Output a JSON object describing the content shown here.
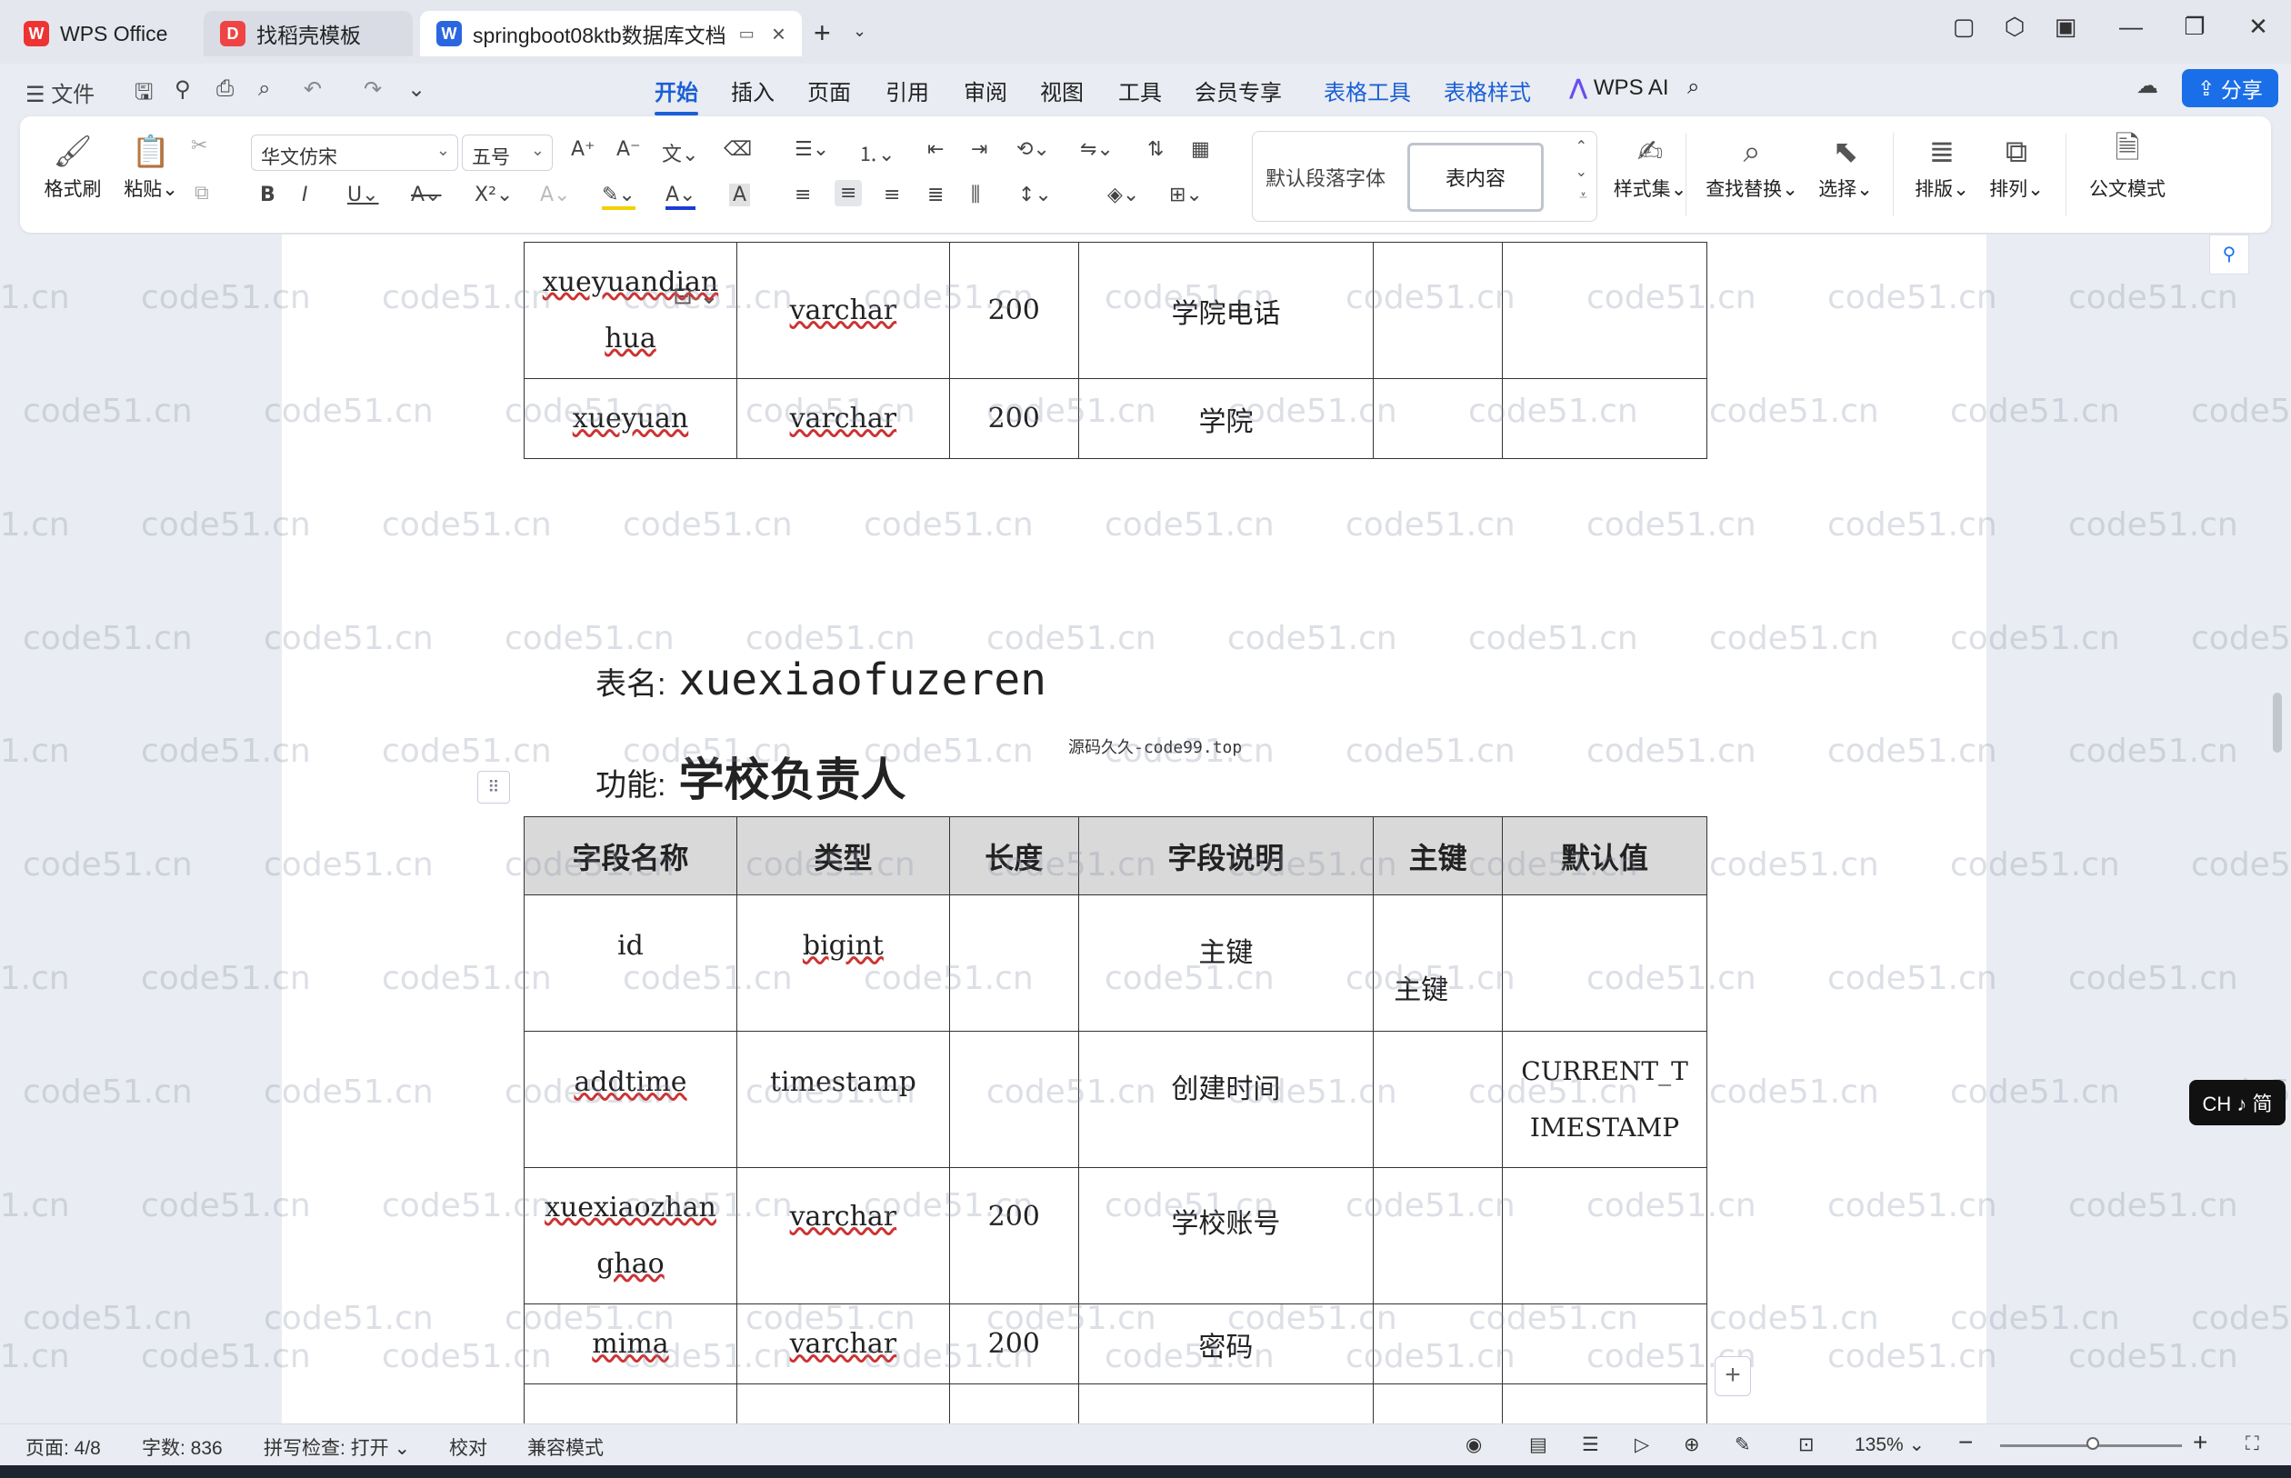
{
  "tabs": {
    "wps": "WPS Office",
    "template": "找稻壳模板",
    "doc": "springboot08ktb数据库文档"
  },
  "menu": {
    "file": "文件",
    "items": [
      "开始",
      "插入",
      "页面",
      "引用",
      "审阅",
      "视图",
      "工具",
      "会员专享",
      "表格工具",
      "表格样式"
    ],
    "wps_ai": "WPS AI",
    "share": "分享"
  },
  "ribbon": {
    "format_painter": "格式刷",
    "paste": "粘贴",
    "font_name": "华文仿宋",
    "font_size": "五号",
    "style_default": "默认段落字体",
    "style_selected": "表内容",
    "styles": "样式集",
    "find_replace": "查找替换",
    "select": "选择",
    "layout": "排版",
    "arrange": "排列",
    "official": "公文模式"
  },
  "prev_table": {
    "rows": [
      {
        "name": "xueyuandianhua",
        "type": "varchar",
        "length": "200",
        "desc": "学院电话",
        "pk": "",
        "default": ""
      },
      {
        "name": "xueyuan",
        "type": "varchar",
        "length": "200",
        "desc": "学院",
        "pk": "",
        "default": ""
      }
    ]
  },
  "table_info": {
    "name_label": "表名:",
    "name_value": "xuexiaofuzeren",
    "func_label": "功能:",
    "func_value": "学校负责人",
    "source": "源码久久-code99.top"
  },
  "main_table": {
    "headers": [
      "字段名称",
      "类型",
      "长度",
      "字段说明",
      "主键",
      "默认值"
    ],
    "rows": [
      {
        "name": "id",
        "type": "bigint",
        "length": "",
        "desc": "主键",
        "pk": "主键",
        "default": ""
      },
      {
        "name": "addtime",
        "type": "timestamp",
        "length": "",
        "desc": "创建时间",
        "pk": "",
        "default": "CURRENT_TIMESTAMP"
      },
      {
        "name": "xuexiaozhanghao",
        "type": "varchar",
        "length": "200",
        "desc": "学校账号",
        "pk": "",
        "default": ""
      },
      {
        "name": "mima",
        "type": "varchar",
        "length": "200",
        "desc": "密码",
        "pk": "",
        "default": ""
      }
    ]
  },
  "watermark": "code51.cn",
  "ime": "CH ♪ 简",
  "status": {
    "page": "页面: 4/8",
    "words": "字数: 836",
    "spell": "拼写检查: 打开",
    "proof": "校对",
    "compat": "兼容模式",
    "zoom": "135%"
  },
  "colors": {
    "accent": "#1a5fd6",
    "share": "#1a6fe8",
    "header_bg": "#d9d9d9"
  }
}
